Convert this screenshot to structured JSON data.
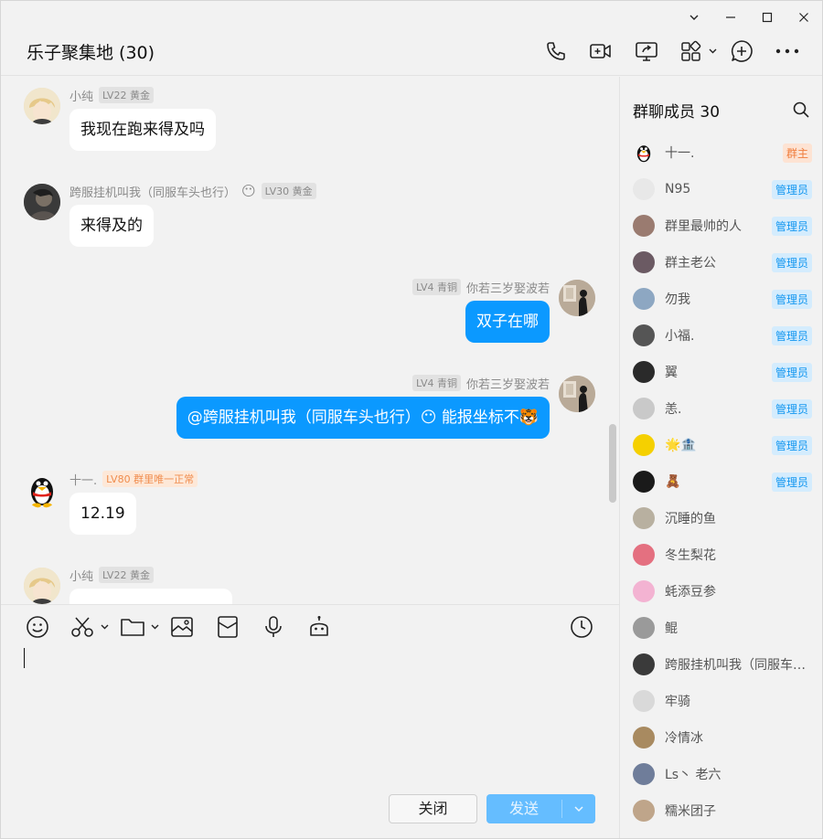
{
  "window": {
    "title": "乐子聚集地 (30)"
  },
  "header": {
    "tools": [
      "phone-icon",
      "video-call-icon",
      "screen-share-icon",
      "apps-icon",
      "add-circle-icon",
      "more-icon"
    ]
  },
  "messages": [
    {
      "sender": "小纯",
      "level": "LV22 黄金",
      "text": "我现在跑来得及吗",
      "side": "in"
    },
    {
      "sender": "跨服挂机叫我（同服车头也行）",
      "level": "LV30 黄金",
      "text": "来得及的",
      "side": "in"
    },
    {
      "sender": "你若三岁娶波若",
      "level": "LV4 青铜",
      "text": "双子在哪",
      "side": "out"
    },
    {
      "sender": "你若三岁娶波若",
      "level": "LV4 青铜",
      "text": "@跨服挂机叫我（同服车头也行）😶 能报坐标不🐯",
      "side": "out"
    },
    {
      "sender": "十一.",
      "level": "LV80 群里唯一正常",
      "text": "12.19",
      "side": "in"
    },
    {
      "sender": "小纯",
      "level": "LV22 黄金",
      "text": "",
      "side": "in"
    }
  ],
  "composer": {
    "close_label": "关闭",
    "send_label": "发送"
  },
  "members_panel": {
    "title": "群聊成员 30",
    "members": [
      {
        "name": "十一.",
        "role": "群主"
      },
      {
        "name": "N95",
        "role": "管理员"
      },
      {
        "name": "群里最帅的人",
        "role": "管理员"
      },
      {
        "name": "群主老公",
        "role": "管理员"
      },
      {
        "name": "勿我",
        "role": "管理员"
      },
      {
        "name": "小福.",
        "role": "管理员"
      },
      {
        "name": "翼",
        "role": "管理员"
      },
      {
        "name": "恙.",
        "role": "管理员"
      },
      {
        "name": "🌟🏦",
        "role": "管理员"
      },
      {
        "name": "🧸",
        "role": "管理员"
      },
      {
        "name": "沉睡的鱼",
        "role": ""
      },
      {
        "name": "冬生梨花",
        "role": ""
      },
      {
        "name": "蚝添豆参",
        "role": ""
      },
      {
        "name": "鲲",
        "role": ""
      },
      {
        "name": "跨服挂机叫我（同服车头也行）",
        "role": ""
      },
      {
        "name": "牢骑",
        "role": ""
      },
      {
        "name": "冷情冰",
        "role": ""
      },
      {
        "name": "Ls丶 老六",
        "role": ""
      },
      {
        "name": "糯米团子",
        "role": ""
      }
    ]
  },
  "colors": {
    "accent": "#0b99ff",
    "send_disabled": "#65bdff",
    "owner_badge": "#f07d3c",
    "admin_badge": "#1296f0"
  }
}
